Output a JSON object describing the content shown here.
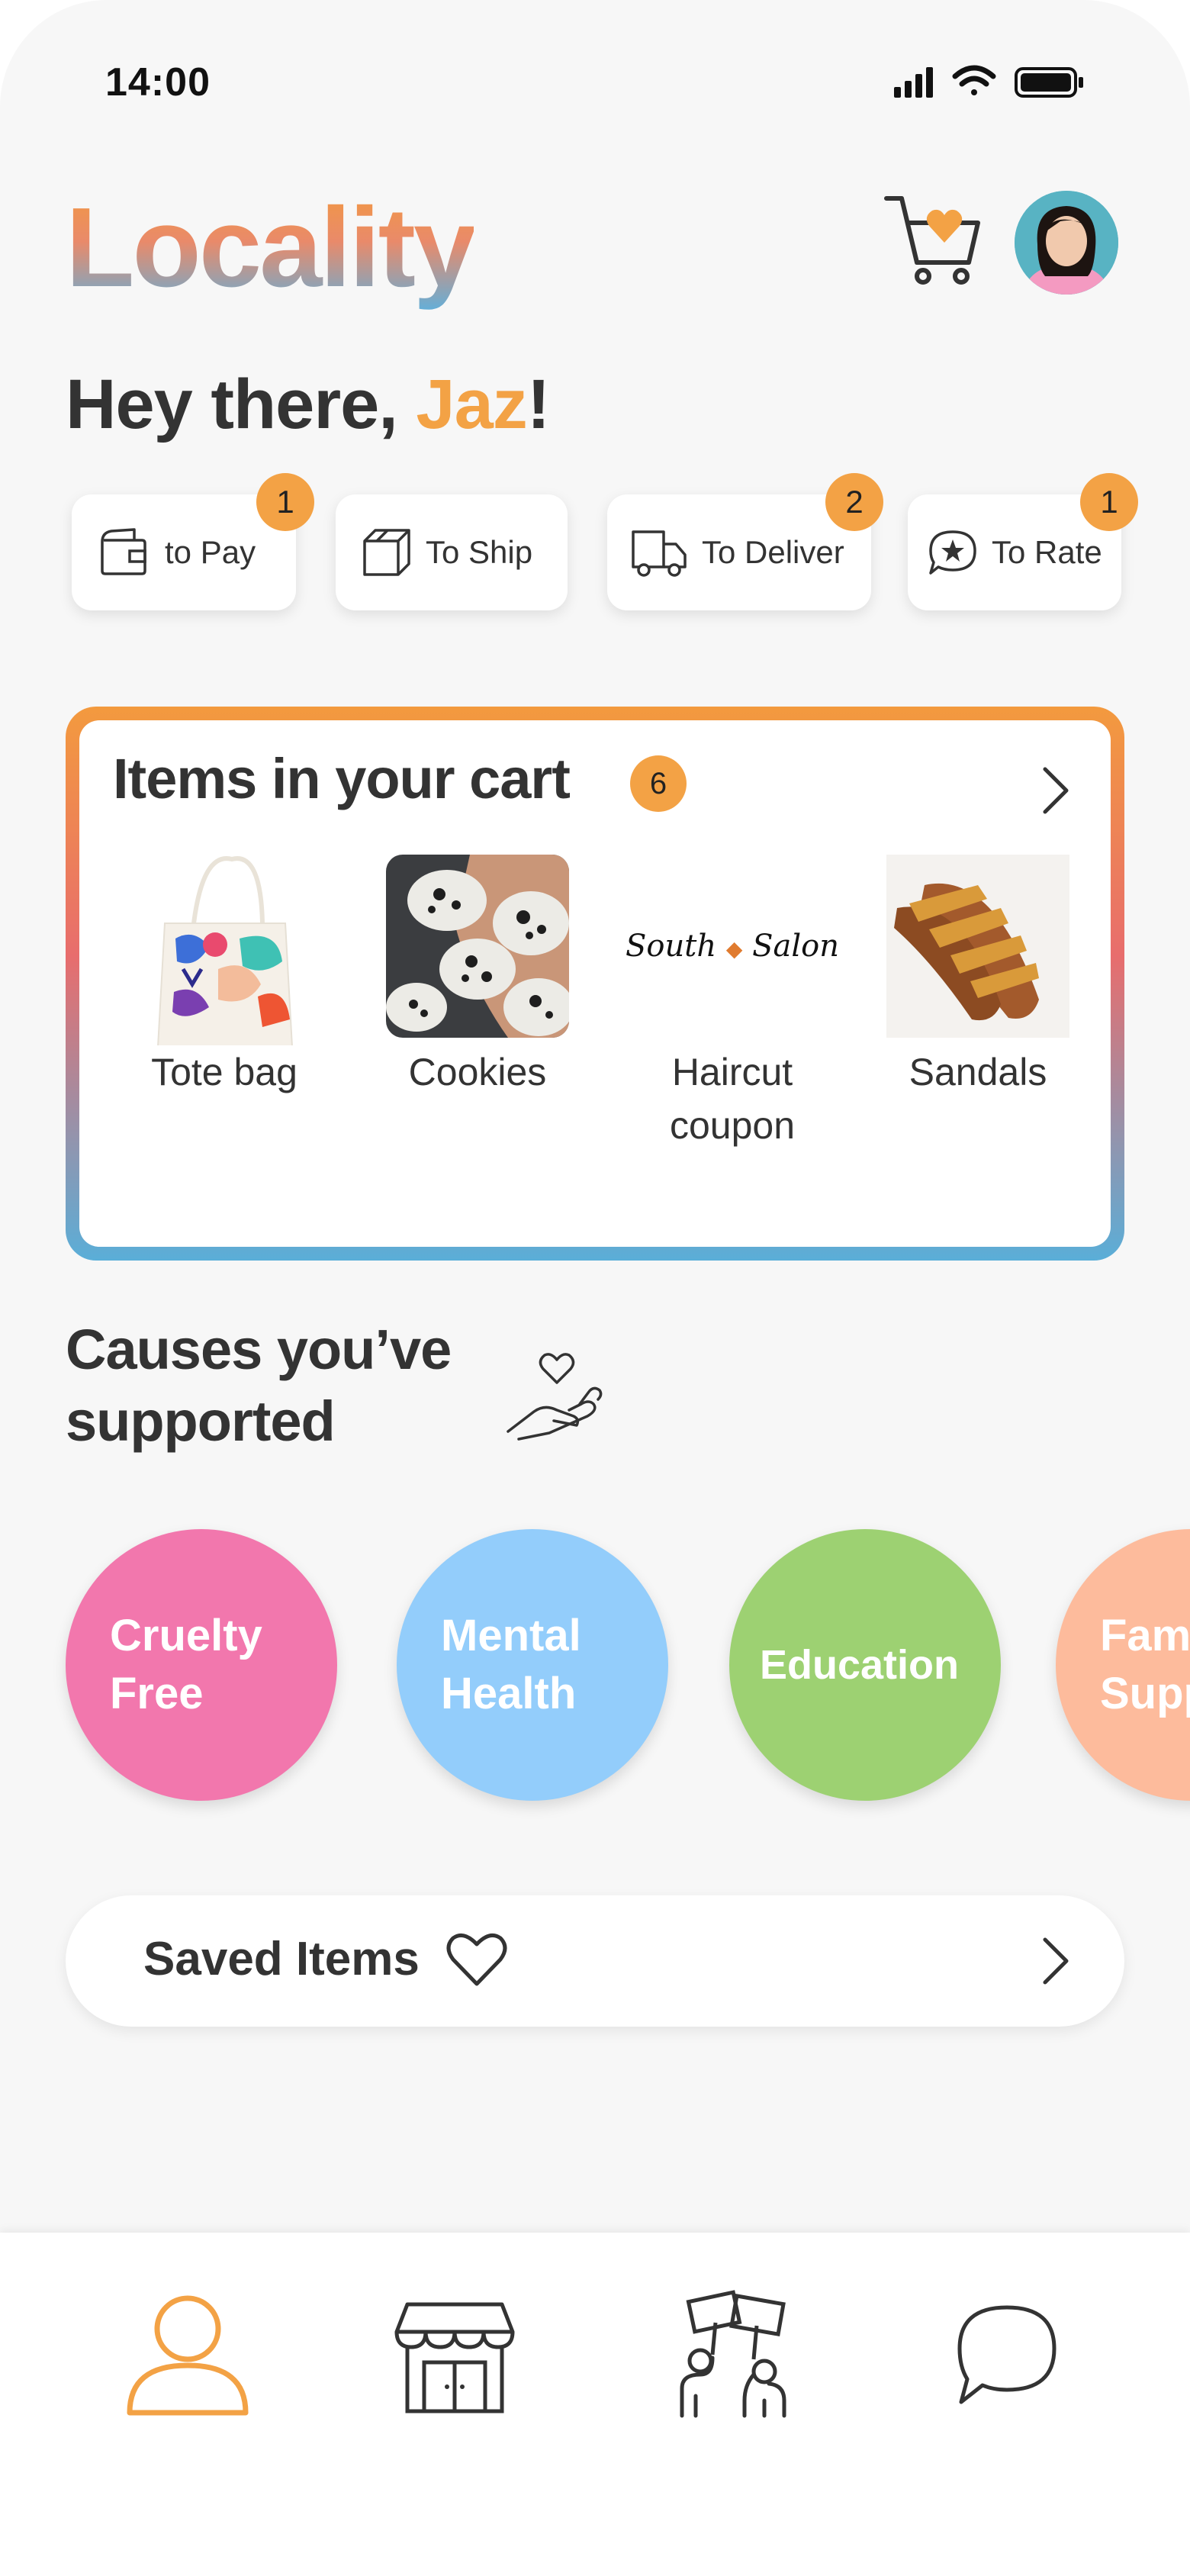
{
  "status_bar": {
    "time": "14:00"
  },
  "header": {
    "logo": "Locality"
  },
  "greeting": {
    "prefix": "Hey there, ",
    "name": "Jaz",
    "suffix": "!"
  },
  "order_status": [
    {
      "label": "to Pay",
      "badge": "1",
      "icon": "wallet-icon"
    },
    {
      "label": "To Ship",
      "badge": "",
      "icon": "box-icon"
    },
    {
      "label": "To Deliver",
      "badge": "2",
      "icon": "truck-icon"
    },
    {
      "label": "To Rate",
      "badge": "1",
      "icon": "star-bubble-icon"
    }
  ],
  "cart": {
    "title": "Items in your cart",
    "count": "6",
    "items": [
      {
        "name": "Tote bag"
      },
      {
        "name": "Cookies"
      },
      {
        "name": "Haircut coupon",
        "logo_text": "South Salon"
      },
      {
        "name": "Sandals"
      }
    ]
  },
  "causes": {
    "title": "Causes you’ve supported",
    "items": [
      {
        "label": "Cruelty Free",
        "color": "#f277ad"
      },
      {
        "label": "Mental Health",
        "color": "#93cdfb"
      },
      {
        "label": "Education",
        "color": "#9dd172"
      },
      {
        "label": "Family Support",
        "color": "#fdbb9c"
      }
    ]
  },
  "saved": {
    "label": "Saved Items"
  },
  "colors": {
    "accent": "#f3a245",
    "text": "#333333"
  },
  "bottom_nav": [
    "profile-icon",
    "store-icon",
    "community-icon",
    "chat-icon"
  ]
}
